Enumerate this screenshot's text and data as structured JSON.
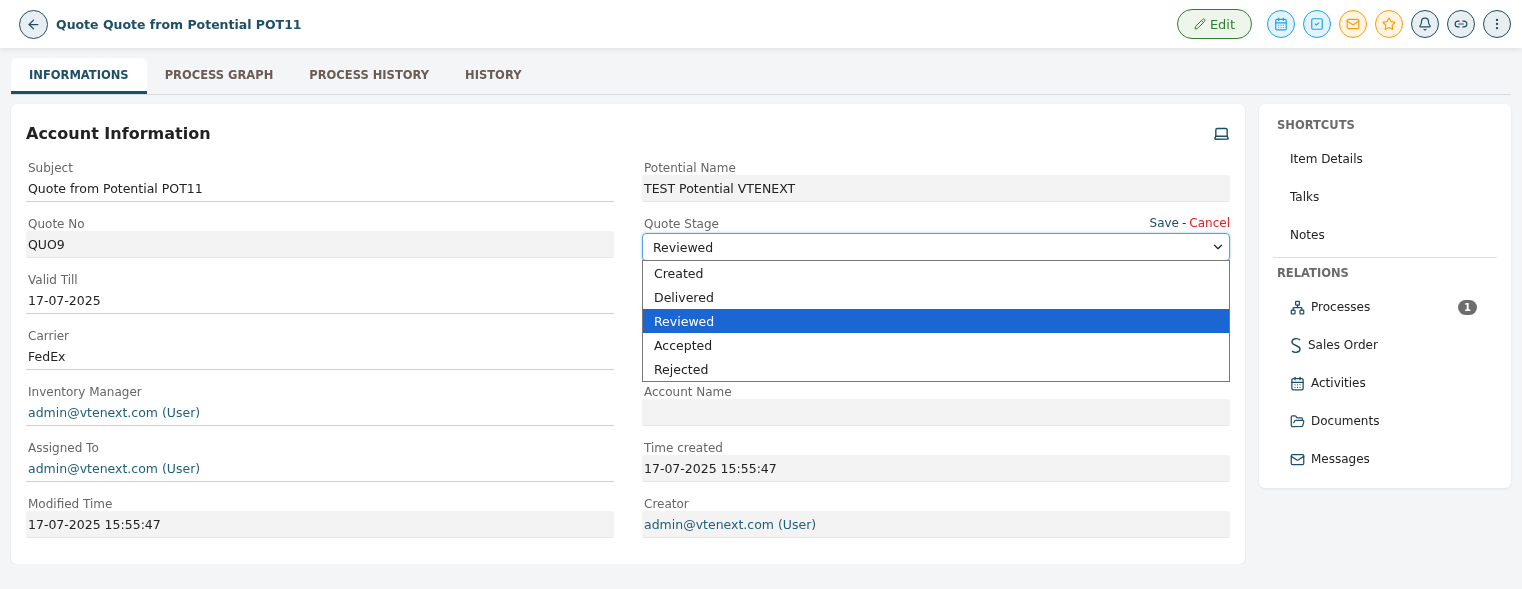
{
  "header": {
    "title": "Quote Quote from Potential POT11",
    "edit_label": "Edit"
  },
  "tabs": [
    {
      "label": "INFORMATIONS",
      "selected": true
    },
    {
      "label": "PROCESS GRAPH",
      "selected": false
    },
    {
      "label": "PROCESS HISTORY",
      "selected": false
    },
    {
      "label": "HISTORY",
      "selected": false
    }
  ],
  "section": {
    "title": "Account Information",
    "rows": [
      {
        "left": {
          "label": "Subject",
          "value": "Quote from Potential POT11",
          "kind": "editable",
          "link": false
        },
        "right": {
          "label": "Potential Name",
          "value": "TEST Potential VTENEXT",
          "kind": "readonly",
          "link": false
        }
      },
      {
        "left": {
          "label": "Quote No",
          "value": "QUO9",
          "kind": "readonly",
          "link": false
        },
        "right": {
          "label": "Quote Stage",
          "value": "Reviewed",
          "kind": "select",
          "save": "Save",
          "separator": "-",
          "cancel": "Cancel",
          "expanded": true,
          "options": [
            {
              "label": "Created",
              "selected": false
            },
            {
              "label": "Delivered",
              "selected": false
            },
            {
              "label": "Reviewed",
              "selected": true
            },
            {
              "label": "Accepted",
              "selected": false
            },
            {
              "label": "Rejected",
              "selected": false
            }
          ]
        }
      },
      {
        "left": {
          "label": "Valid Till",
          "value": "17-07-2025",
          "kind": "editable",
          "link": false
        }
      },
      {
        "left": {
          "label": "Carrier",
          "value": "FedEx",
          "kind": "editable",
          "link": false
        }
      },
      {
        "left": {
          "label": "Inventory Manager",
          "value": "admin@vtenext.com (User)",
          "kind": "editable",
          "link": true
        },
        "right": {
          "label": "Account Name",
          "kind": "readonly"
        }
      },
      {
        "left": {
          "label": "Assigned To",
          "value": "admin@vtenext.com (User)",
          "kind": "editable",
          "link": true
        },
        "right": {
          "label": "Time created",
          "value": "17-07-2025 15:55:47",
          "kind": "readonly",
          "link": false
        }
      },
      {
        "left": {
          "label": "Modified Time",
          "value": "17-07-2025 15:55:47",
          "kind": "readonly",
          "link": false
        },
        "right": {
          "label": "Creator",
          "value": "admin@vtenext.com (User)",
          "kind": "readonly",
          "link": true
        }
      }
    ]
  },
  "sidebar": {
    "shortcuts_title": "SHORTCUTS",
    "shortcuts": [
      "Item Details",
      "Talks",
      "Notes"
    ],
    "relations_title": "RELATIONS",
    "relations": [
      {
        "label": "Processes",
        "kind": "processes",
        "badge": "1"
      },
      {
        "label": "Sales Order",
        "kind": "sales"
      },
      {
        "label": "Activities",
        "kind": "calendar"
      },
      {
        "label": "Documents",
        "kind": "folder"
      },
      {
        "label": "Messages",
        "kind": "mail"
      }
    ]
  }
}
